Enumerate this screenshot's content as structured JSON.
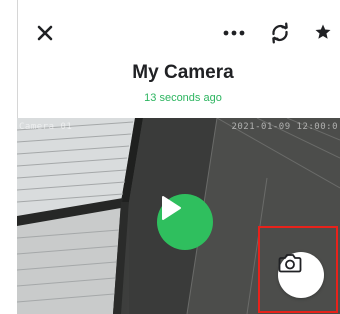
{
  "header": {
    "title": "My Camera",
    "last_updated": "13 seconds ago",
    "close_icon": "close-icon",
    "more_icon": "more-options-icon",
    "refresh_icon": "refresh-icon",
    "favorite_icon": "star-icon"
  },
  "feed": {
    "osd_left": "Camera 01",
    "osd_right": "2021-01-09 12:00:0",
    "play_icon": "play-icon",
    "snapshot_icon": "camera-icon"
  },
  "colors": {
    "accent_green": "#2fbf5e",
    "subtitle_green": "#2db560",
    "highlight_red": "#e8221b",
    "text_dark": "#202124"
  }
}
